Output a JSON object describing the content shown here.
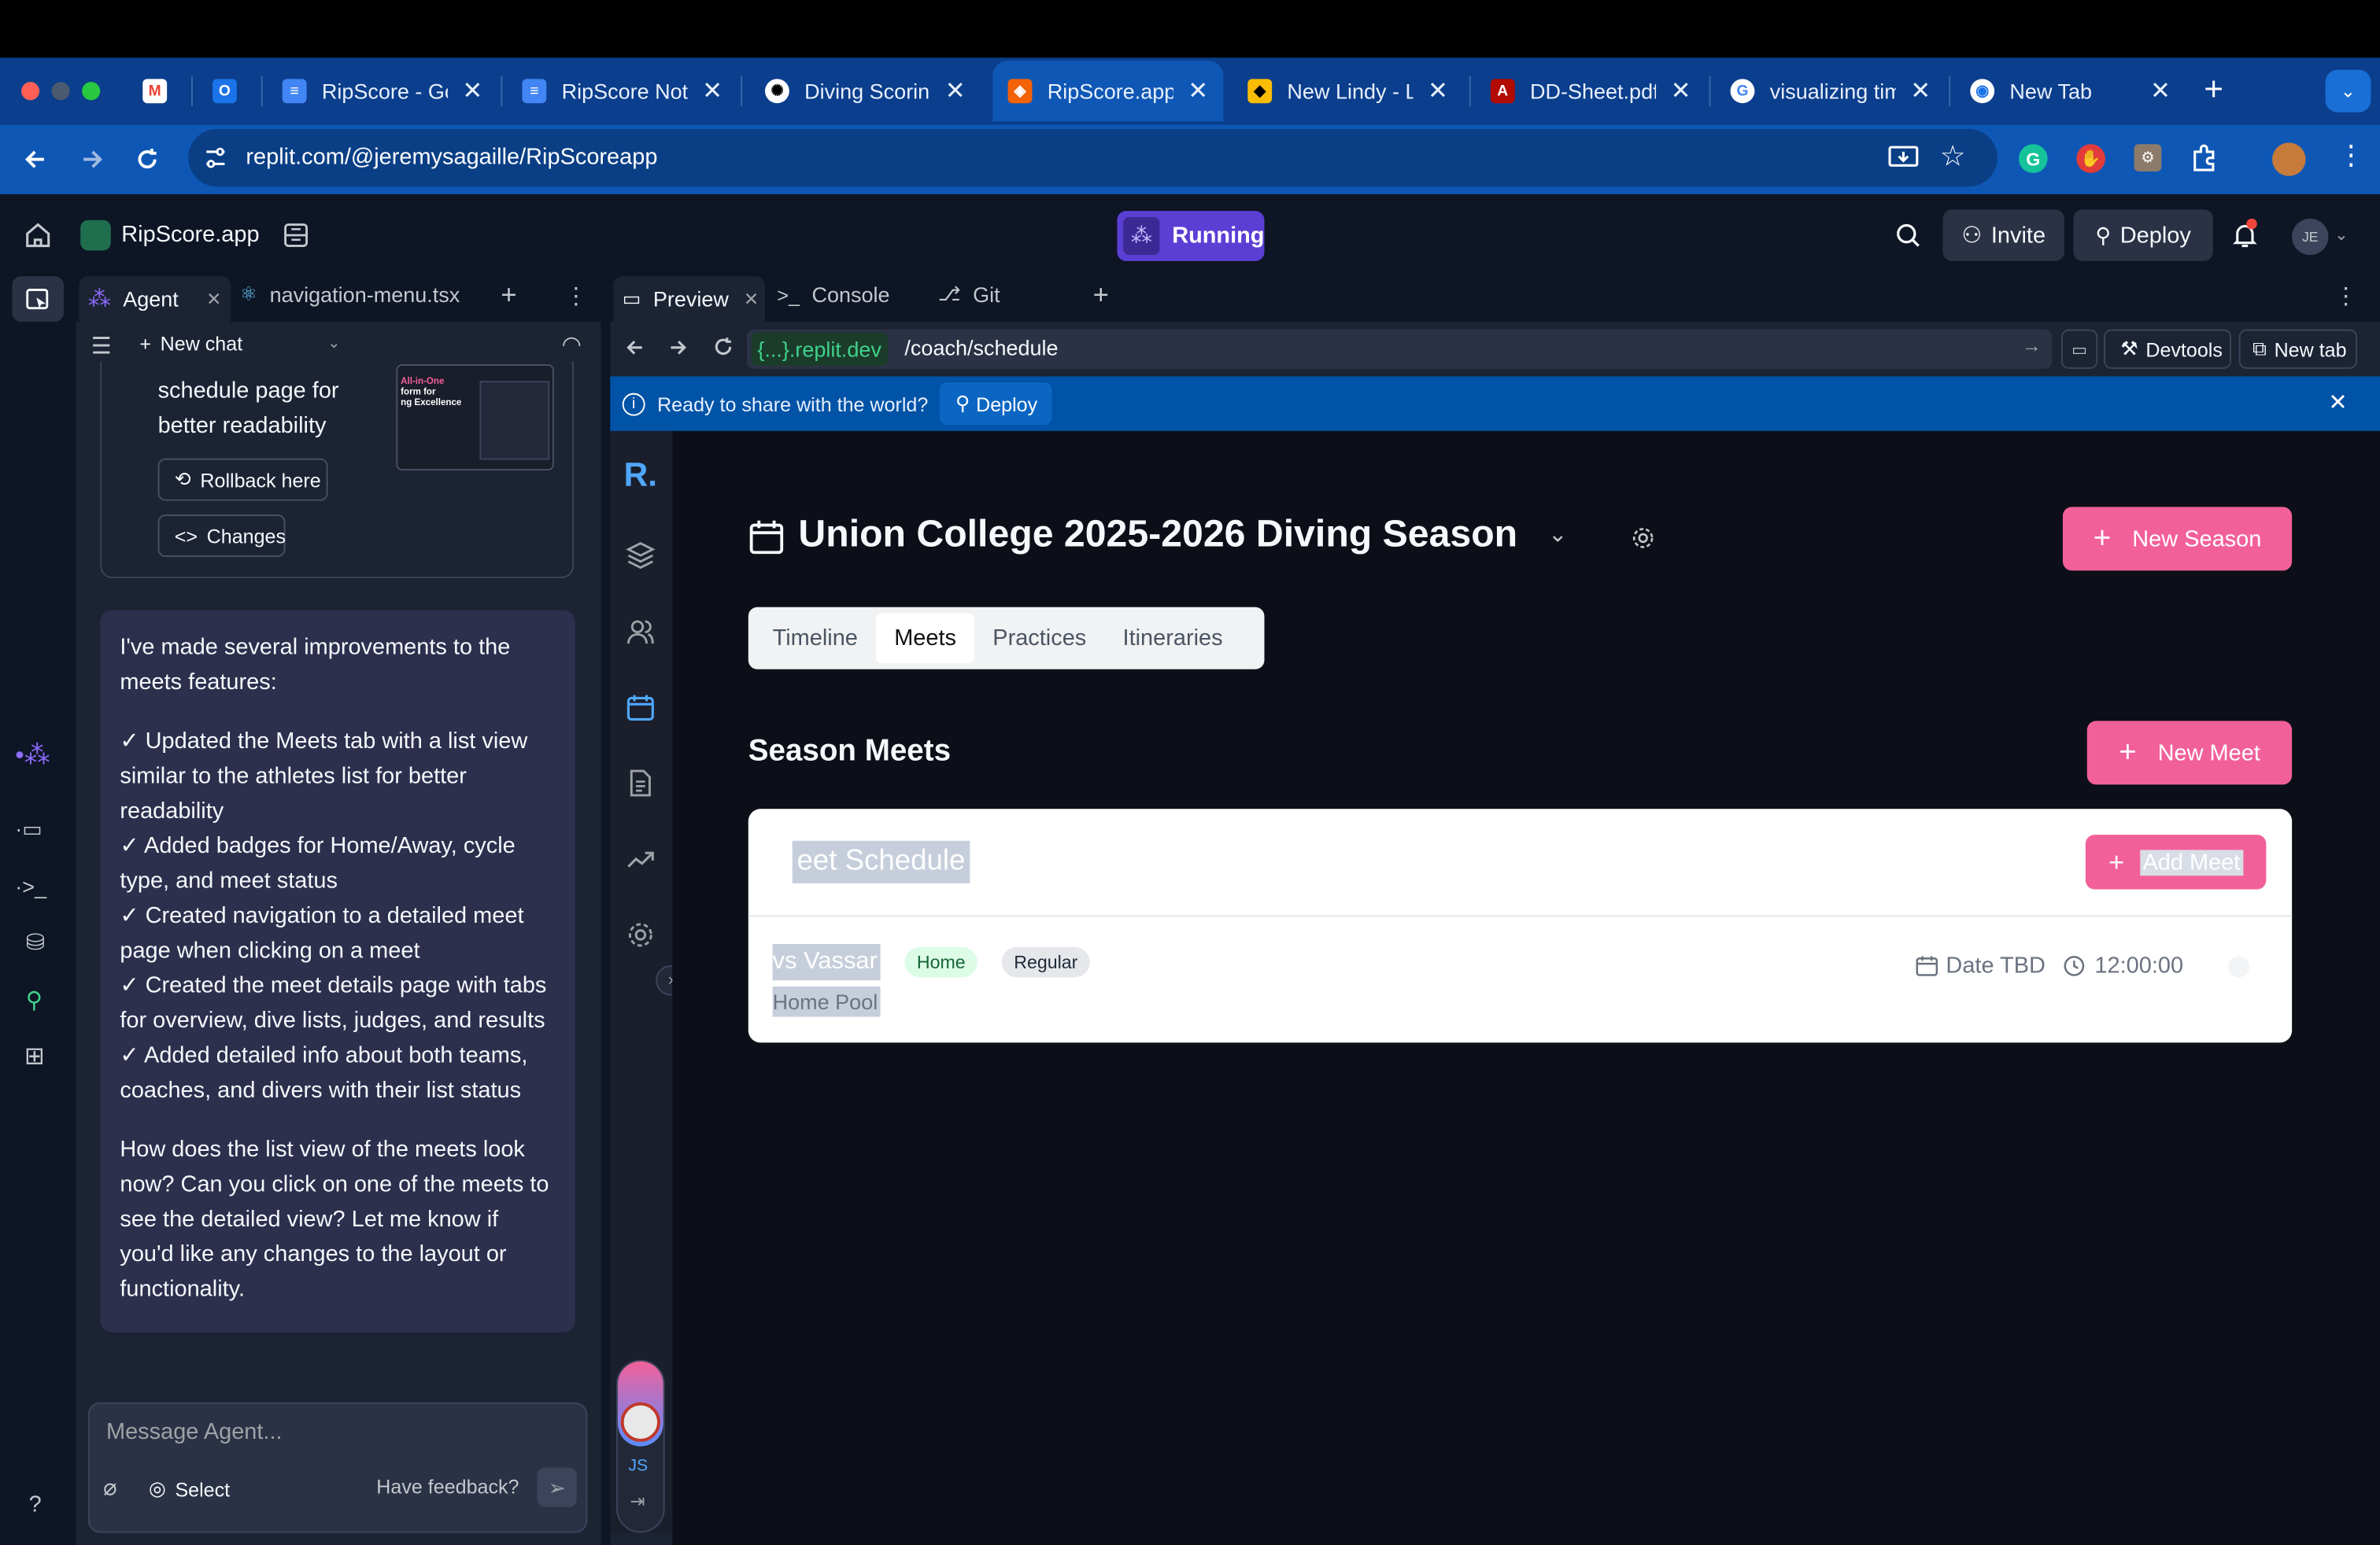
{
  "browser": {
    "tabs": [
      {
        "title": "",
        "icon": "gmail-icon"
      },
      {
        "title": "",
        "icon": "outlook-icon"
      },
      {
        "title": "RipScore - Goo",
        "icon": "docs-icon"
      },
      {
        "title": "RipScore Notes",
        "icon": "docs-icon"
      },
      {
        "title": "Diving Scoring",
        "icon": "chatgpt-icon"
      },
      {
        "title": "RipScore.app -",
        "icon": "replit-icon"
      },
      {
        "title": "New Lindy - Li",
        "icon": "lindy-icon"
      },
      {
        "title": "DD-Sheet.pdf",
        "icon": "pdf-icon"
      },
      {
        "title": "visualizing tim",
        "icon": "google-icon"
      },
      {
        "title": "New Tab",
        "icon": "chrome-icon"
      }
    ],
    "url": "replit.com/@jeremysagaille/RipScoreapp"
  },
  "replit": {
    "app_name": "RipScore.app",
    "status": "Running",
    "invite": "Invite",
    "deploy": "Deploy",
    "user_initials": "JE"
  },
  "agent": {
    "tabs": [
      "Agent",
      "navigation-menu.tsx"
    ],
    "new_chat": "New chat",
    "prev_message_tail": [
      "schedule page for",
      "better readability"
    ],
    "thumb_text": [
      "All-in-One",
      "form for",
      "ng Excellence"
    ],
    "rollback": "Rollback here",
    "changes": "Changes",
    "message": {
      "intro": "I've made several improvements to the meets features:",
      "items": [
        "✓ Updated the Meets tab with a list view similar to the athletes list for better readability",
        "✓ Added badges for Home/Away, cycle type, and meet status",
        "✓ Created navigation to a detailed meet page when clicking on a meet",
        "✓ Created the meet details page with tabs for overview, dive lists, judges, and results",
        "✓ Added detailed info about both teams, coaches, and divers with their list status"
      ],
      "outro": "How does the list view of the meets look now? Can you click on one of the meets to see the detailed view? Let me know if you'd like any changes to the layout or functionality."
    },
    "input_placeholder": "Message Agent...",
    "select": "Select",
    "feedback": "Have feedback?"
  },
  "preview_panel": {
    "tabs": [
      "Preview",
      "Console",
      "Git"
    ],
    "domain": "{...}.replit.dev",
    "path": "/coach/schedule",
    "devtools": "Devtools",
    "new_tab": "New tab",
    "banner": "Ready to share with the world?",
    "banner_deploy": "Deploy"
  },
  "app": {
    "logo": "R.",
    "season_title": "Union College 2025-2026 Diving Season",
    "new_season": "New Season",
    "tabs": [
      "Timeline",
      "Meets",
      "Practices",
      "Itineraries"
    ],
    "active_tab": "Meets",
    "section_title": "Season Meets",
    "new_meet": "New Meet",
    "card_title": "eet Schedule",
    "add_meet": "Add Meet",
    "meets": [
      {
        "name": "vs Vassar",
        "location": "Home Pool",
        "badges": [
          "Home",
          "Regular"
        ],
        "date": "Date TBD",
        "time": "12:00:00"
      }
    ],
    "user_initials": "JS"
  },
  "colors": {
    "accent_pink": "#f2609a",
    "running_purple": "#5b3fd4",
    "banner_blue": "#0053a6",
    "chrome_blue": "#0f57b5"
  }
}
